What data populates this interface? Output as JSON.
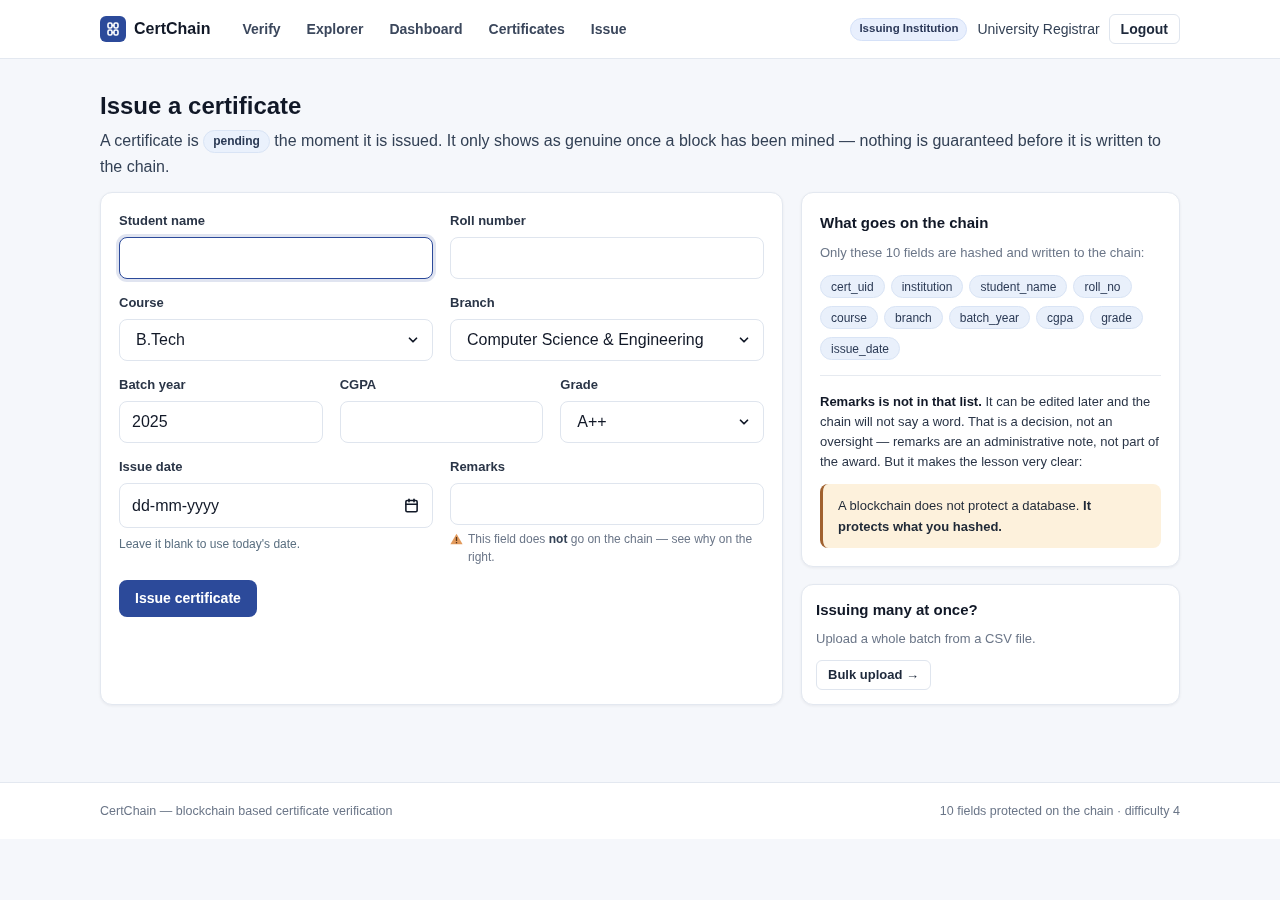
{
  "header": {
    "brand": "CertChain",
    "nav": [
      "Verify",
      "Explorer",
      "Dashboard",
      "Certificates",
      "Issue"
    ],
    "role_badge": "Issuing Institution",
    "user": "University Registrar",
    "logout": "Logout"
  },
  "page": {
    "title": "Issue a certificate",
    "intro_before": "A certificate is",
    "intro_badge": "pending",
    "intro_after": "the moment it is issued. It only shows as genuine once a block has been mined — nothing is guaranteed before it is written to the chain."
  },
  "form": {
    "rows": [
      [
        {
          "kind": "text",
          "label": "Student name",
          "focused": true
        },
        {
          "kind": "text",
          "label": "Roll number",
          "focused": false
        }
      ],
      [
        {
          "kind": "select",
          "label": "Course",
          "value": "B.Tech",
          "focused": false
        },
        {
          "kind": "select",
          "label": "Branch",
          "value": "Computer Science & Engineering",
          "focused": false
        }
      ],
      [
        {
          "kind": "text",
          "label": "Batch year",
          "value": "2025",
          "focused": false
        },
        {
          "kind": "text",
          "label": "CGPA",
          "focused": false
        },
        {
          "kind": "select",
          "label": "Grade",
          "value": "A++",
          "focused": false
        }
      ],
      [
        {
          "kind": "date",
          "label": "Issue date",
          "placeholder": "dd-mm-yyyy",
          "focused": false,
          "hint": {
            "kind": "note",
            "text": "Leave it blank to use today's date."
          }
        },
        {
          "kind": "text",
          "label": "Remarks",
          "focused": false,
          "hint": {
            "kind": "warning",
            "text": "This field does **not** go on the chain — see why on the right."
          }
        }
      ]
    ],
    "submit": "Issue certificate"
  },
  "chain_panel": {
    "title": "What goes on the chain",
    "description": "Only these 10 fields are hashed and written to the chain:",
    "fields": [
      "cert_uid",
      "institution",
      "student_name",
      "roll_no",
      "course",
      "branch",
      "batch_year",
      "cgpa",
      "grade",
      "issue_date"
    ],
    "note": "**Remarks is not in that list.** It can be edited later and the chain will not say a word. That is a decision, not an oversight — remarks are an administrative note, not part of the award. But it makes the lesson very clear:",
    "callout": "A blockchain does not protect a database. **It protects what you hashed.**"
  },
  "bulk_panel": {
    "title": "Issuing many at once?",
    "description": "Upload a whole batch from a CSV file.",
    "button": "Bulk upload →"
  },
  "footer": {
    "left": "CertChain — blockchain based certificate verification",
    "right": "10 fields protected on the chain · difficulty 4"
  }
}
